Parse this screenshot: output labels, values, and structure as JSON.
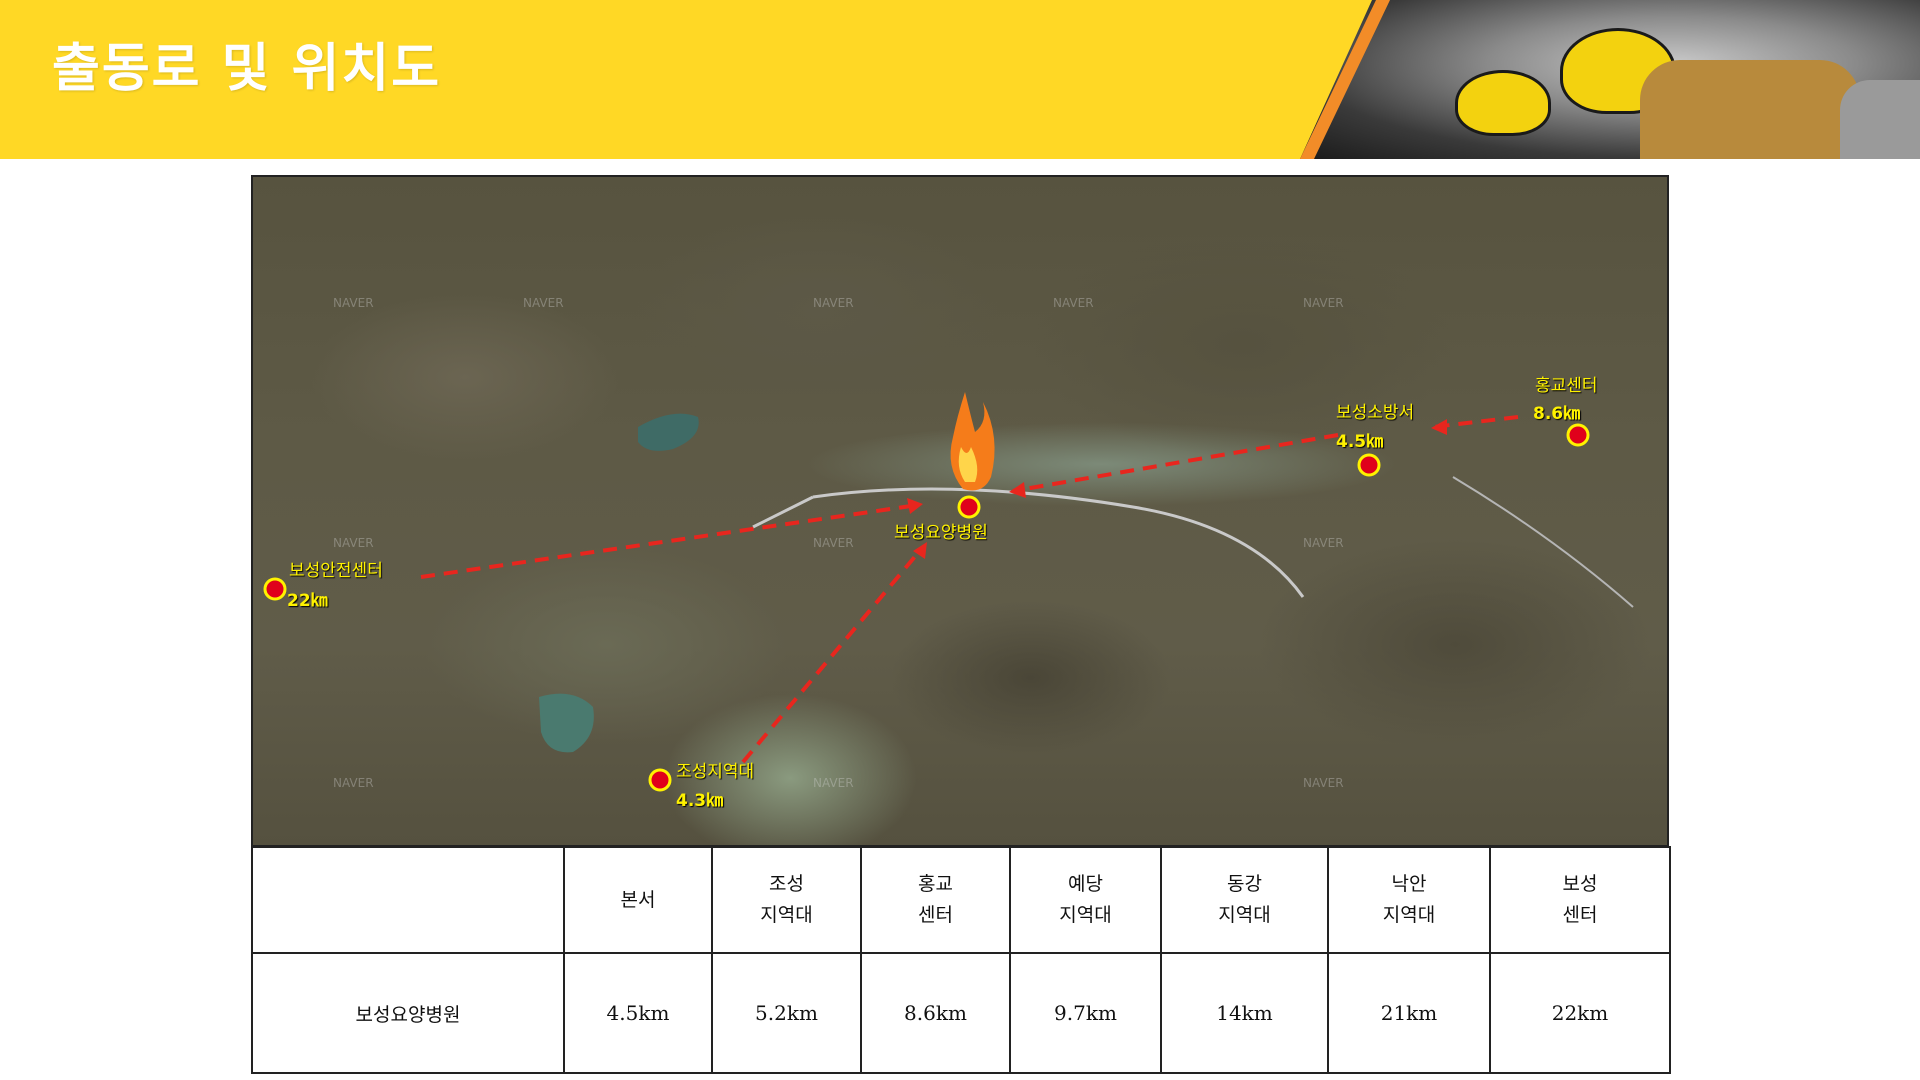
{
  "header": {
    "title": "출동로 및 위치도"
  },
  "map": {
    "fire_label": "보성요양병원",
    "stations": [
      {
        "id": "hongyo",
        "name": "홍교센터",
        "distance": "8.6㎞"
      },
      {
        "id": "boseong-fire",
        "name": "보성소방서",
        "distance": "4.5㎞"
      },
      {
        "id": "boseong-safety",
        "name": "보성안전센터",
        "distance": "22㎞"
      },
      {
        "id": "joseong",
        "name": "조성지역대",
        "distance": "4.3㎞"
      }
    ],
    "watermark": "NAVER",
    "colors": {
      "marker_fill": "#E0001B",
      "marker_ring": "#FFF200",
      "route": "#E8261E",
      "label": "#FFF200"
    }
  },
  "table": {
    "headers": [
      {
        "line1": "",
        "line2": ""
      },
      {
        "line1": "본서",
        "line2": ""
      },
      {
        "line1": "조성",
        "line2": "지역대"
      },
      {
        "line1": "홍교",
        "line2": "센터"
      },
      {
        "line1": "예당",
        "line2": "지역대"
      },
      {
        "line1": "동강",
        "line2": "지역대"
      },
      {
        "line1": "낙안",
        "line2": "지역대"
      },
      {
        "line1": "보성",
        "line2": "센터"
      }
    ],
    "rows": [
      {
        "label": "보성요양병원",
        "values": [
          "4.5km",
          "5.2km",
          "8.6km",
          "9.7km",
          "14km",
          "21km",
          "22km"
        ]
      }
    ]
  },
  "colors": {
    "banner": "#FFD825",
    "banner_accent": "#F28C28"
  }
}
